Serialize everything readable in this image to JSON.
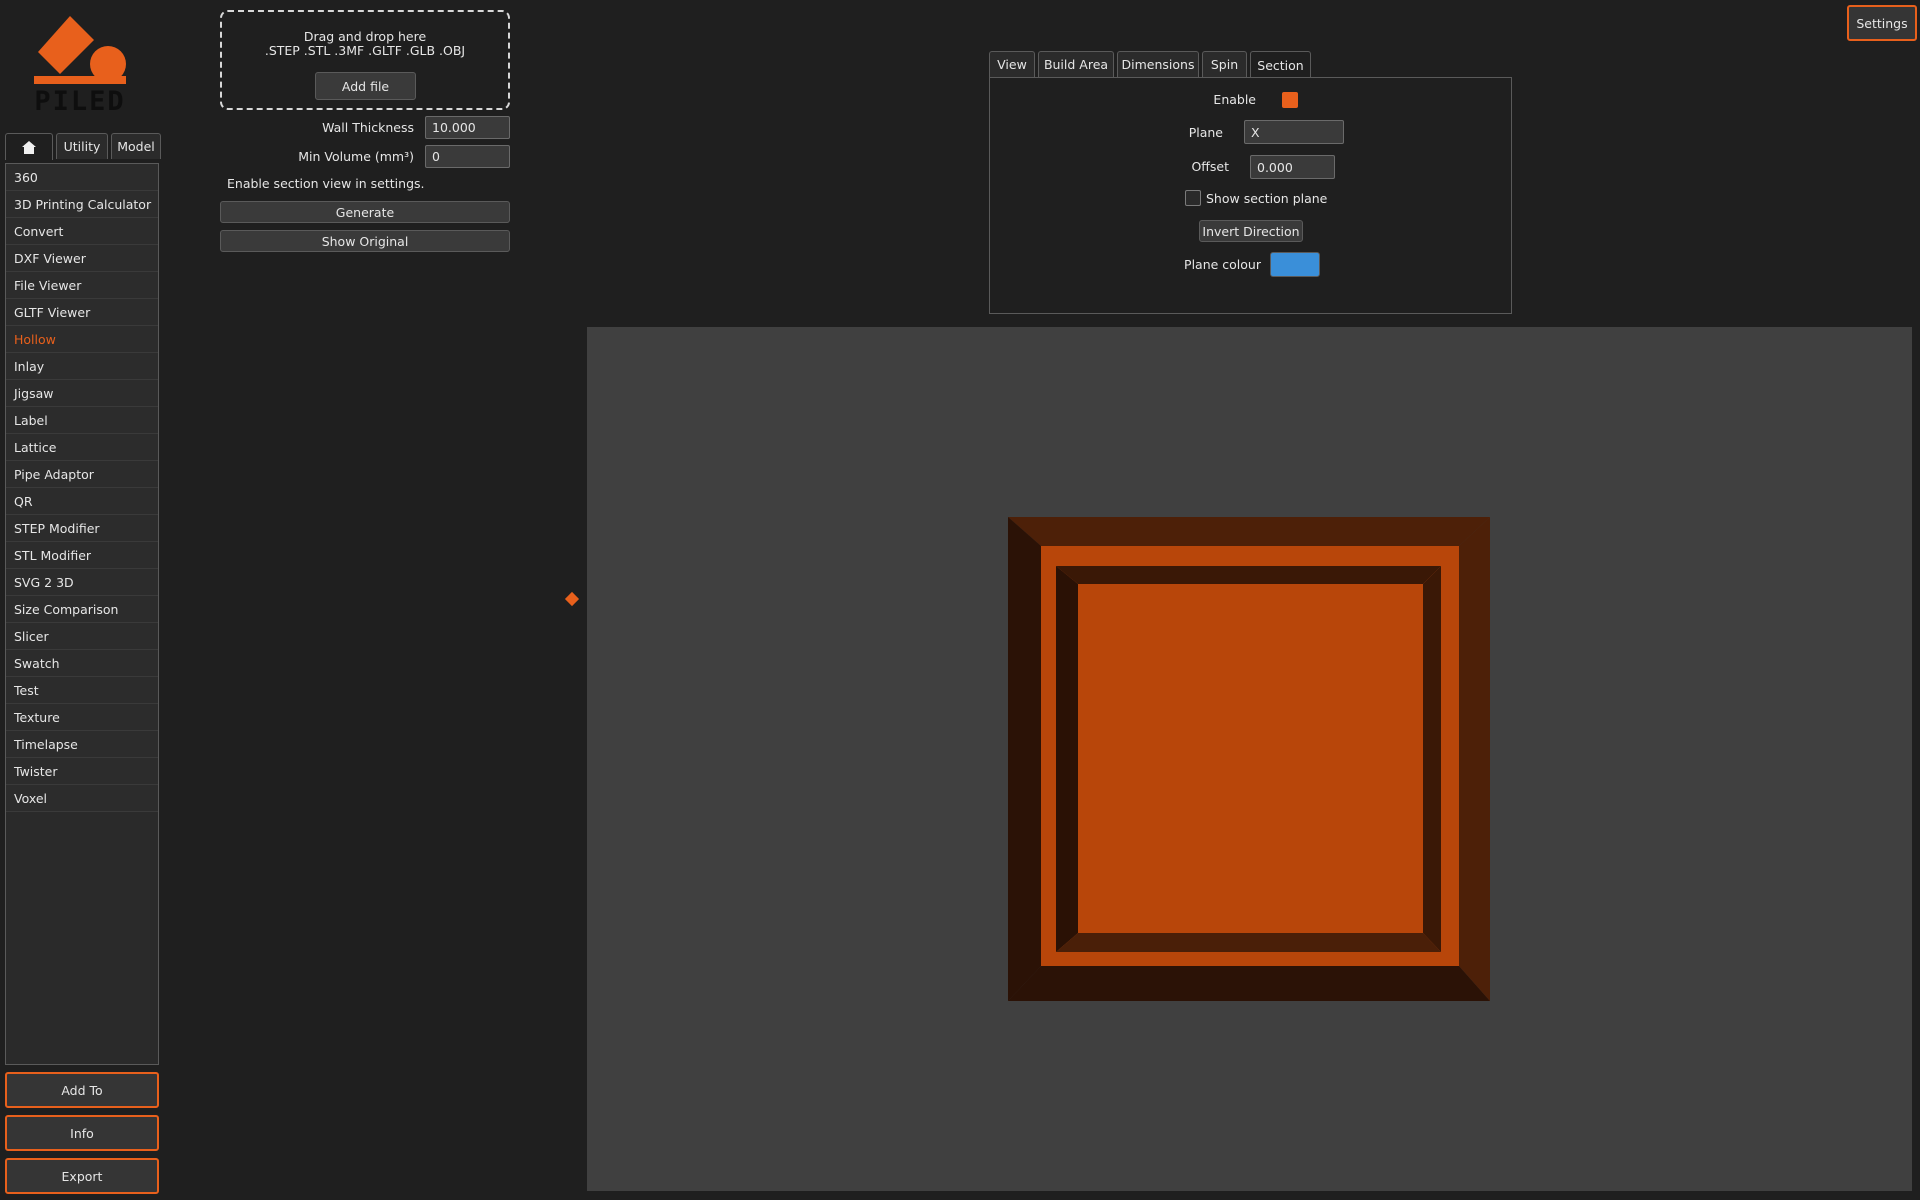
{
  "logo": {
    "text": "PILED"
  },
  "nav_tabs": [
    {
      "icon": "home-icon"
    },
    {
      "label": "Utility"
    },
    {
      "label": "Model"
    }
  ],
  "tool_list": [
    {
      "label": "360"
    },
    {
      "label": "3D Printing Calculator"
    },
    {
      "label": "Convert"
    },
    {
      "label": "DXF Viewer"
    },
    {
      "label": "File Viewer"
    },
    {
      "label": "GLTF Viewer"
    },
    {
      "label": "Hollow",
      "active": true
    },
    {
      "label": "Inlay"
    },
    {
      "label": "Jigsaw"
    },
    {
      "label": "Label"
    },
    {
      "label": "Lattice"
    },
    {
      "label": "Pipe Adaptor"
    },
    {
      "label": "QR"
    },
    {
      "label": "STEP Modifier"
    },
    {
      "label": "STL Modifier"
    },
    {
      "label": "SVG 2 3D"
    },
    {
      "label": "Size Comparison"
    },
    {
      "label": "Slicer"
    },
    {
      "label": "Swatch"
    },
    {
      "label": "Test"
    },
    {
      "label": "Texture"
    },
    {
      "label": "Timelapse"
    },
    {
      "label": "Twister"
    },
    {
      "label": "Voxel"
    }
  ],
  "bottom_buttons": {
    "add_to": "Add To",
    "info": "Info",
    "export": "Export"
  },
  "dropzone": {
    "line1": "Drag and drop here",
    "line2": ".STEP .STL .3MF .GLTF .GLB .OBJ",
    "add_file": "Add file"
  },
  "hollow": {
    "wall_thickness_label": "Wall Thickness",
    "wall_thickness_value": "10.000",
    "min_volume_label": "Min Volume (mm³)",
    "min_volume_value": "0",
    "hint": "Enable section view in settings.",
    "generate": "Generate",
    "show_original": "Show Original"
  },
  "settings_button": "Settings",
  "view_tabs": [
    {
      "label": "View"
    },
    {
      "label": "Build Area"
    },
    {
      "label": "Dimensions"
    },
    {
      "label": "Spin"
    },
    {
      "label": "Section",
      "active": true
    }
  ],
  "section": {
    "enable_label": "Enable",
    "enabled": true,
    "plane_label": "Plane",
    "plane_value": "X",
    "offset_label": "Offset",
    "offset_value": "0.000",
    "show_plane_label": "Show section plane",
    "show_plane_checked": false,
    "invert_label": "Invert Direction",
    "plane_colour_label": "Plane colour",
    "plane_colour": "#3a8fd9"
  },
  "colors": {
    "accent": "#e8601c",
    "viewport_bg": "#404040"
  }
}
